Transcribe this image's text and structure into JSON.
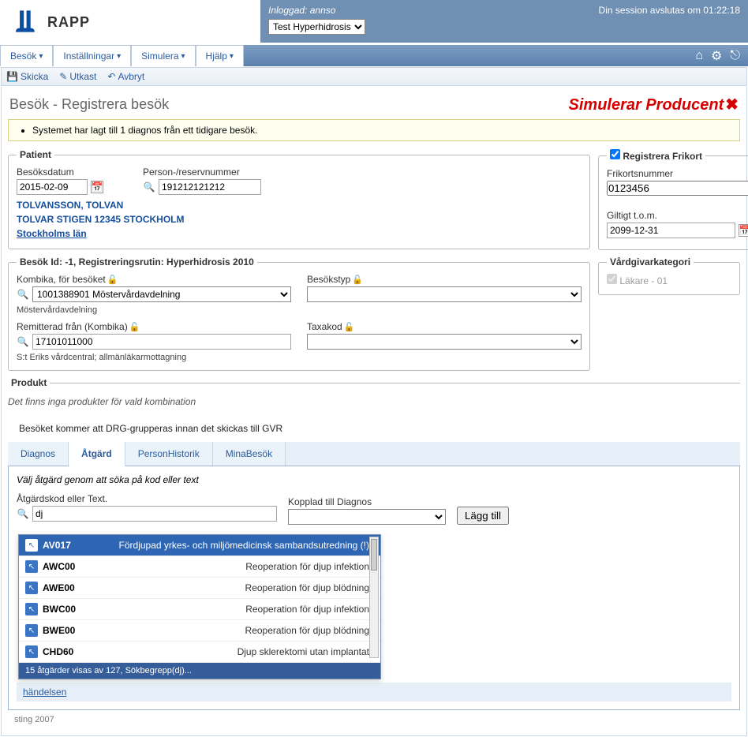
{
  "header": {
    "app_name": "RAPP",
    "logged_in_label": "Inloggad:",
    "logged_in_user": "annso",
    "context_select": "Test Hyperhidrosis",
    "session_text": "Din session avslutas om",
    "session_time": "01:22:18"
  },
  "nav": {
    "items": [
      "Besök",
      "Inställningar",
      "Simulera",
      "Hjälp"
    ]
  },
  "toolbar": {
    "send": "Skicka",
    "draft": "Utkast",
    "cancel": "Avbryt"
  },
  "page": {
    "title": "Besök - Registrera besök",
    "sim_banner": "Simulerar Producent"
  },
  "info": {
    "message": "Systemet har lagt till 1 diagnos från ett tidigare besök."
  },
  "patient": {
    "legend": "Patient",
    "visit_date_label": "Besöksdatum",
    "visit_date": "2015-02-09",
    "pnr_label": "Person-/reservnummer",
    "pnr": "191212121212",
    "name": "TOLVANSSON, TOLVAN",
    "address": "TOLVAR STIGEN  12345  STOCKHOLM",
    "region": "Stockholms län"
  },
  "frikort": {
    "register_label": "Registrera Frikort",
    "number_label": "Frikortsnummer",
    "number": "0123456",
    "valid_label": "Giltigt t.o.m.",
    "valid": "2099-12-31"
  },
  "visit": {
    "legend": "Besök  Id: -1, Registreringsrutin: Hyperhidrosis 2010",
    "kombika_label": "Kombika, för besöket",
    "kombika": "1001388901  Möstervårdavdelning",
    "kombika_sub": "Möstervårdavdelning",
    "besokstyp_label": "Besökstyp",
    "remit_label": "Remitterad från (Kombika)",
    "remit": "17101011000",
    "remit_sub": "S:t Eriks vårdcentral; allmänläkarmottagning",
    "taxakod_label": "Taxakod"
  },
  "vardgivar": {
    "legend": "Vårdgivarkategori",
    "opt": "Läkare - 01"
  },
  "product": {
    "legend": "Produkt",
    "none": "Det finns inga produkter för vald kombination",
    "drg": "Besöket kommer att DRG-grupperas innan det skickas till GVR"
  },
  "tabs": {
    "items": [
      "Diagnos",
      "Åtgärd",
      "PersonHistorik",
      "MinaBesök"
    ],
    "active": 1
  },
  "atgard": {
    "hint": "Välj åtgärd genom att söka på kod eller text",
    "code_label": "Åtgärdskod eller Text.",
    "code_value": "dj",
    "kopplad_label": "Kopplad till Diagnos",
    "add_btn": "Lägg till",
    "footer_status": "15 åtgärder visas av 127, Sökbegrepp(dj)..."
  },
  "suggestions": [
    {
      "code": "AV017",
      "desc": "Fördjupad yrkes- och miljömedicinsk sambandsutredning (!)"
    },
    {
      "code": "AWC00",
      "desc": "Reoperation för djup infektion"
    },
    {
      "code": "AWE00",
      "desc": "Reoperation för djup blödning"
    },
    {
      "code": "BWC00",
      "desc": "Reoperation för djup infektion"
    },
    {
      "code": "BWE00",
      "desc": "Reoperation för djup blödning"
    },
    {
      "code": "CHD60",
      "desc": "Djup sklerektomi utan implantat"
    }
  ],
  "handelse_link": "händelsen",
  "credit": "sting 2007"
}
